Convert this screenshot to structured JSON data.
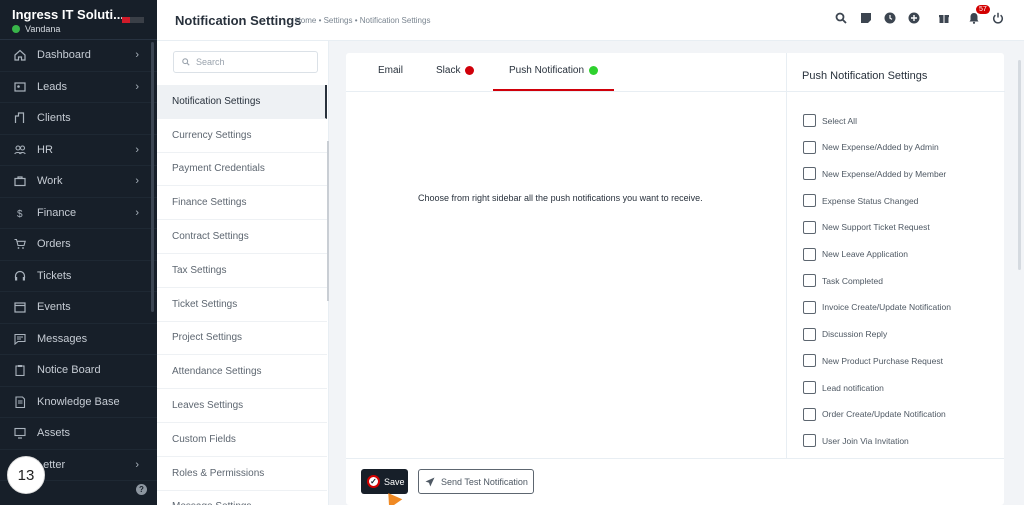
{
  "brand": {
    "name": "Ingress IT Soluti...",
    "user": "Vandana"
  },
  "sidebar": {
    "items": [
      {
        "label": "Dashboard",
        "icon": "house-icon",
        "arrow": true
      },
      {
        "label": "Leads",
        "icon": "contact-card-icon",
        "arrow": true
      },
      {
        "label": "Clients",
        "icon": "building-icon",
        "arrow": false
      },
      {
        "label": "HR",
        "icon": "people-icon",
        "arrow": true
      },
      {
        "label": "Work",
        "icon": "briefcase-icon",
        "arrow": true
      },
      {
        "label": "Finance",
        "icon": "dollar-icon",
        "arrow": true
      },
      {
        "label": "Orders",
        "icon": "cart-icon",
        "arrow": false
      },
      {
        "label": "Tickets",
        "icon": "headset-icon",
        "arrow": false
      },
      {
        "label": "Events",
        "icon": "calendar-icon",
        "arrow": false
      },
      {
        "label": "Messages",
        "icon": "chat-icon",
        "arrow": false
      },
      {
        "label": "Notice Board",
        "icon": "clipboard-icon",
        "arrow": false
      },
      {
        "label": "Knowledge Base",
        "icon": "book-icon",
        "arrow": false
      },
      {
        "label": "Assets",
        "icon": "monitor-icon",
        "arrow": false
      },
      {
        "label": "Letter",
        "icon": "mail-icon",
        "arrow": true
      }
    ],
    "step_badge": "13",
    "help": "?"
  },
  "header": {
    "title": "Notification Settings",
    "breadcrumb": "Home • Settings • Notification Settings",
    "notification_count": "57"
  },
  "settings_menu": {
    "search_placeholder": "Search",
    "items": [
      "Notification Settings",
      "Currency Settings",
      "Payment Credentials",
      "Finance Settings",
      "Contract Settings",
      "Tax Settings",
      "Ticket Settings",
      "Project Settings",
      "Attendance Settings",
      "Leaves Settings",
      "Custom Fields",
      "Roles & Permissions",
      "Message Settings"
    ],
    "active_index": 0
  },
  "tabs": [
    {
      "label": "Email",
      "dot": null
    },
    {
      "label": "Slack",
      "dot": "#d0000a"
    },
    {
      "label": "Push Notification",
      "dot": "#2ed12e"
    }
  ],
  "content": {
    "message": "Choose from right sidebar all the push notifications you want to receive."
  },
  "push_panel": {
    "title": "Push Notification Settings",
    "options": [
      "Select All",
      "New Expense/Added by Admin",
      "New Expense/Added by Member",
      "Expense Status Changed",
      "New Support Ticket Request",
      "New Leave Application",
      "Task Completed",
      "Invoice Create/Update Notification",
      "Discussion Reply",
      "New Product Purchase Request",
      "Lead notification",
      "Order Create/Update Notification",
      "User Join Via Invitation"
    ]
  },
  "footer": {
    "save_label": "Save",
    "test_label": "Send Test Notification"
  },
  "colors": {
    "sidebar_bg": "#171f29",
    "accent_red": "#d0000a",
    "online_green": "#39b54a"
  }
}
